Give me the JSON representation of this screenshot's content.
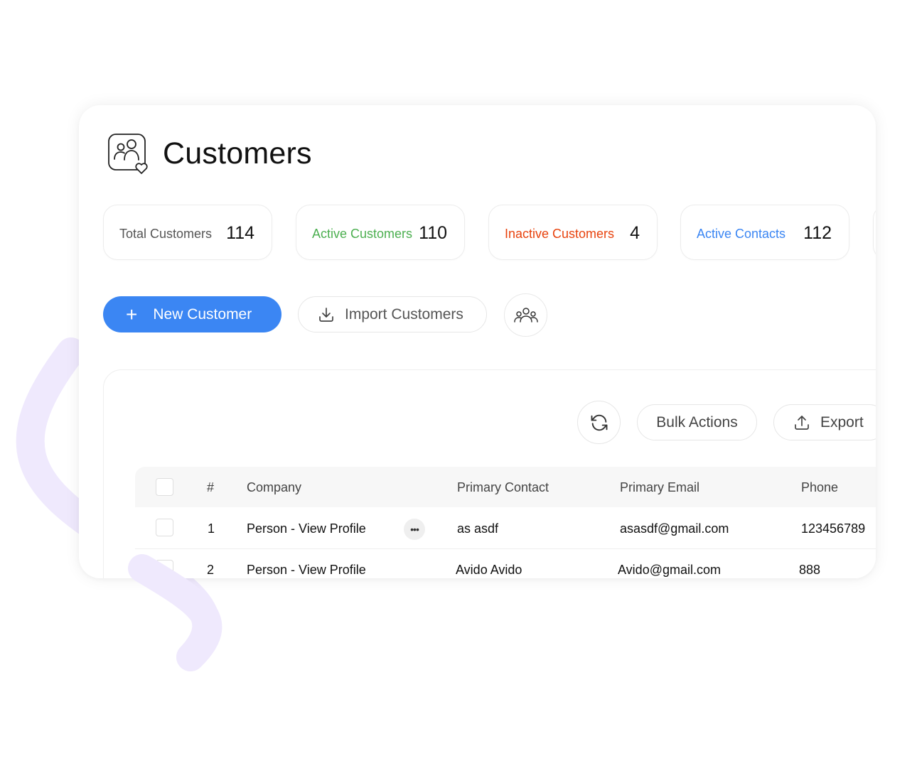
{
  "page": {
    "title": "Customers"
  },
  "stats": [
    {
      "label": "Total Customers",
      "value": "114",
      "color": "#555555"
    },
    {
      "label": "Active Customers",
      "value": "110",
      "color": "#4caf50"
    },
    {
      "label": "Inactive Customers",
      "value": "4",
      "color": "#e8430e"
    },
    {
      "label": "Active Contacts",
      "value": "112",
      "color": "#3b86f3"
    }
  ],
  "actions": {
    "new_customer": "New Customer",
    "import_customers": "Import Customers",
    "bulk_actions": "Bulk Actions",
    "export": "Export"
  },
  "table": {
    "columns": [
      "#",
      "Company",
      "Primary Contact",
      "Primary Email",
      "Phone"
    ],
    "rows": [
      {
        "num": "1",
        "company": "Person - View Profile",
        "contact": "as asdf",
        "email": "asasdf@gmail.com",
        "phone": "123456789"
      },
      {
        "num": "2",
        "company": "Person - View Profile",
        "contact": "Avido Avido",
        "email": "Avido@gmail.com",
        "phone": "888"
      }
    ],
    "more_icon": "•••"
  },
  "colors": {
    "accent": "#3b86f3",
    "squiggle": "#efe9fd"
  }
}
